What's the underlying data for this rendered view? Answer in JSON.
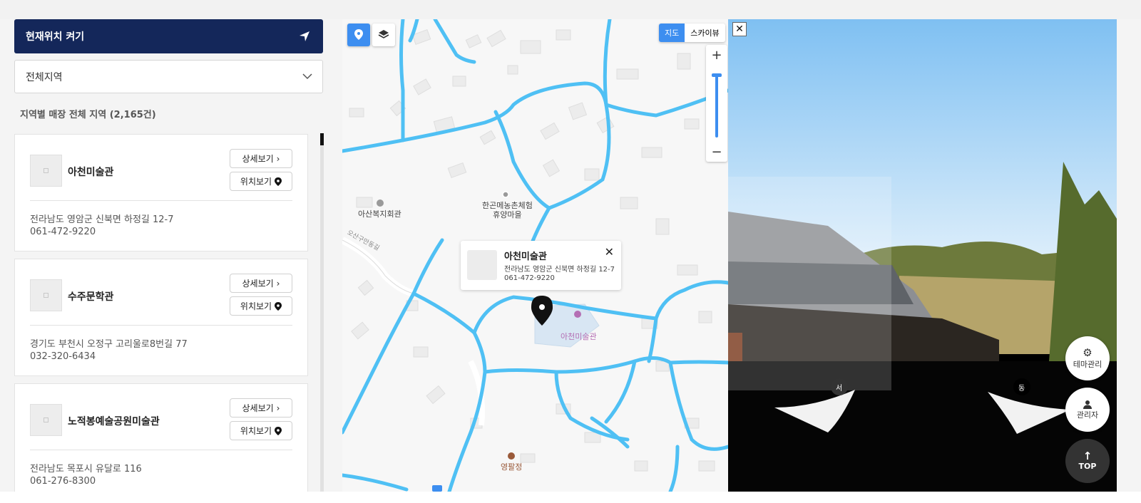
{
  "left_panel": {
    "location_button": "현재위치 켜기",
    "region_select": "전체지역",
    "count_label": "지역별 매장 전체 지역 (2,165건)",
    "detail_label": "상세보기",
    "where_label": "위치보기",
    "stores": [
      {
        "name": "아천미술관",
        "address": "전라남도 영암군 신북면 하정길 12-7",
        "phone": "061-472-9220"
      },
      {
        "name": "수주문학관",
        "address": "경기도 부천시 오정구 고리울로8번길 77",
        "phone": "032-320-6434"
      },
      {
        "name": "노적봉예술공원미술관",
        "address": "전라남도 목포시 유달로 116",
        "phone": "061-276-8300"
      }
    ]
  },
  "map": {
    "type_map": "지도",
    "type_sky": "스카이뷰",
    "zoom_in": "+",
    "zoom_out": "−",
    "labels": {
      "hall": "아산복지회관",
      "village_1": "한곤메농촌체험",
      "village_2": "휴양마을",
      "museum": "아천미술관",
      "pavilion": "영팔정",
      "road": "오산구만동길"
    },
    "popup": {
      "title": "아천미술관",
      "address": "전라남도 영암군 신북면 하정길 12-7",
      "phone": "061-472-9220"
    },
    "road_color": "#4fc0f4"
  },
  "streetview": {
    "west": "서",
    "east": "동",
    "theme": "테마관리",
    "admin": "관리자",
    "top": "TOP"
  },
  "colors": {
    "primary": "#14275a",
    "accent": "#3d8ef0"
  }
}
